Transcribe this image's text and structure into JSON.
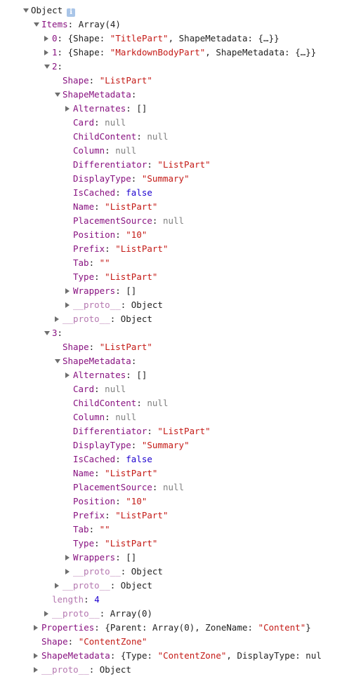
{
  "root": {
    "label": "Object",
    "info_icon": "info-icon",
    "info_glyph": "i"
  },
  "rows": [
    {
      "depth": 0,
      "toggle": "expanded",
      "segs": [
        {
          "t": "Object",
          "c": "p"
        }
      ],
      "badge": true,
      "name": "root-object-node"
    },
    {
      "depth": 1,
      "toggle": "expanded",
      "segs": [
        {
          "t": "Items",
          "c": "k"
        },
        {
          "t": ": Array(4)",
          "c": "p"
        }
      ],
      "name": "items-node"
    },
    {
      "depth": 2,
      "toggle": "collapsed",
      "segs": [
        {
          "t": "0",
          "c": "k"
        },
        {
          "t": ": {Shape: ",
          "c": "p"
        },
        {
          "t": "\"TitlePart\"",
          "c": "s"
        },
        {
          "t": ", ShapeMetadata: {…}}",
          "c": "p"
        }
      ],
      "name": "items-entry-0"
    },
    {
      "depth": 2,
      "toggle": "collapsed",
      "segs": [
        {
          "t": "1",
          "c": "k"
        },
        {
          "t": ": {Shape: ",
          "c": "p"
        },
        {
          "t": "\"MarkdownBodyPart\"",
          "c": "s"
        },
        {
          "t": ", ShapeMetadata: {…}}",
          "c": "p"
        }
      ],
      "name": "items-entry-1"
    },
    {
      "depth": 2,
      "toggle": "expanded",
      "segs": [
        {
          "t": "2",
          "c": "k"
        },
        {
          "t": ":",
          "c": "p"
        }
      ],
      "name": "items-entry-2"
    },
    {
      "depth": 3,
      "toggle": "none",
      "segs": [
        {
          "t": "Shape",
          "c": "k"
        },
        {
          "t": ": ",
          "c": "p"
        },
        {
          "t": "\"ListPart\"",
          "c": "s"
        }
      ],
      "name": "property-shape"
    },
    {
      "depth": 3,
      "toggle": "expanded",
      "segs": [
        {
          "t": "ShapeMetadata",
          "c": "k"
        },
        {
          "t": ":",
          "c": "p"
        }
      ],
      "name": "shape-metadata-node"
    },
    {
      "depth": 4,
      "toggle": "collapsed",
      "segs": [
        {
          "t": "Alternates",
          "c": "k"
        },
        {
          "t": ": []",
          "c": "p"
        }
      ],
      "name": "property-alternates"
    },
    {
      "depth": 4,
      "toggle": "none",
      "segs": [
        {
          "t": "Card",
          "c": "k"
        },
        {
          "t": ": ",
          "c": "p"
        },
        {
          "t": "null",
          "c": "nul"
        }
      ],
      "name": "property-card"
    },
    {
      "depth": 4,
      "toggle": "none",
      "segs": [
        {
          "t": "ChildContent",
          "c": "k"
        },
        {
          "t": ": ",
          "c": "p"
        },
        {
          "t": "null",
          "c": "nul"
        }
      ],
      "name": "property-child-content"
    },
    {
      "depth": 4,
      "toggle": "none",
      "segs": [
        {
          "t": "Column",
          "c": "k"
        },
        {
          "t": ": ",
          "c": "p"
        },
        {
          "t": "null",
          "c": "nul"
        }
      ],
      "name": "property-column"
    },
    {
      "depth": 4,
      "toggle": "none",
      "segs": [
        {
          "t": "Differentiator",
          "c": "k"
        },
        {
          "t": ": ",
          "c": "p"
        },
        {
          "t": "\"ListPart\"",
          "c": "s"
        }
      ],
      "name": "property-differentiator"
    },
    {
      "depth": 4,
      "toggle": "none",
      "segs": [
        {
          "t": "DisplayType",
          "c": "k"
        },
        {
          "t": ": ",
          "c": "p"
        },
        {
          "t": "\"Summary\"",
          "c": "s"
        }
      ],
      "name": "property-display-type"
    },
    {
      "depth": 4,
      "toggle": "none",
      "segs": [
        {
          "t": "IsCached",
          "c": "k"
        },
        {
          "t": ": ",
          "c": "p"
        },
        {
          "t": "false",
          "c": "n"
        }
      ],
      "name": "property-is-cached"
    },
    {
      "depth": 4,
      "toggle": "none",
      "segs": [
        {
          "t": "Name",
          "c": "k"
        },
        {
          "t": ": ",
          "c": "p"
        },
        {
          "t": "\"ListPart\"",
          "c": "s"
        }
      ],
      "name": "property-name"
    },
    {
      "depth": 4,
      "toggle": "none",
      "segs": [
        {
          "t": "PlacementSource",
          "c": "k"
        },
        {
          "t": ": ",
          "c": "p"
        },
        {
          "t": "null",
          "c": "nul"
        }
      ],
      "name": "property-placement-source"
    },
    {
      "depth": 4,
      "toggle": "none",
      "segs": [
        {
          "t": "Position",
          "c": "k"
        },
        {
          "t": ": ",
          "c": "p"
        },
        {
          "t": "\"10\"",
          "c": "s"
        }
      ],
      "name": "property-position"
    },
    {
      "depth": 4,
      "toggle": "none",
      "segs": [
        {
          "t": "Prefix",
          "c": "k"
        },
        {
          "t": ": ",
          "c": "p"
        },
        {
          "t": "\"ListPart\"",
          "c": "s"
        }
      ],
      "name": "property-prefix"
    },
    {
      "depth": 4,
      "toggle": "none",
      "segs": [
        {
          "t": "Tab",
          "c": "k"
        },
        {
          "t": ": ",
          "c": "p"
        },
        {
          "t": "\"\"",
          "c": "s"
        }
      ],
      "name": "property-tab"
    },
    {
      "depth": 4,
      "toggle": "none",
      "segs": [
        {
          "t": "Type",
          "c": "k"
        },
        {
          "t": ": ",
          "c": "p"
        },
        {
          "t": "\"ListPart\"",
          "c": "s"
        }
      ],
      "name": "property-type"
    },
    {
      "depth": 4,
      "toggle": "collapsed",
      "segs": [
        {
          "t": "Wrappers",
          "c": "k"
        },
        {
          "t": ": []",
          "c": "p"
        }
      ],
      "name": "property-wrappers"
    },
    {
      "depth": 4,
      "toggle": "collapsed",
      "segs": [
        {
          "t": "__proto__",
          "c": "k dim"
        },
        {
          "t": ": Object",
          "c": "p"
        }
      ],
      "name": "proto-node"
    },
    {
      "depth": 3,
      "toggle": "collapsed",
      "segs": [
        {
          "t": "__proto__",
          "c": "k dim"
        },
        {
          "t": ": Object",
          "c": "p"
        }
      ],
      "name": "proto-node"
    },
    {
      "depth": 2,
      "toggle": "expanded",
      "segs": [
        {
          "t": "3",
          "c": "k"
        },
        {
          "t": ":",
          "c": "p"
        }
      ],
      "name": "items-entry-3"
    },
    {
      "depth": 3,
      "toggle": "none",
      "segs": [
        {
          "t": "Shape",
          "c": "k"
        },
        {
          "t": ": ",
          "c": "p"
        },
        {
          "t": "\"ListPart\"",
          "c": "s"
        }
      ],
      "name": "property-shape"
    },
    {
      "depth": 3,
      "toggle": "expanded",
      "segs": [
        {
          "t": "ShapeMetadata",
          "c": "k"
        },
        {
          "t": ":",
          "c": "p"
        }
      ],
      "name": "shape-metadata-node"
    },
    {
      "depth": 4,
      "toggle": "collapsed",
      "segs": [
        {
          "t": "Alternates",
          "c": "k"
        },
        {
          "t": ": []",
          "c": "p"
        }
      ],
      "name": "property-alternates"
    },
    {
      "depth": 4,
      "toggle": "none",
      "segs": [
        {
          "t": "Card",
          "c": "k"
        },
        {
          "t": ": ",
          "c": "p"
        },
        {
          "t": "null",
          "c": "nul"
        }
      ],
      "name": "property-card"
    },
    {
      "depth": 4,
      "toggle": "none",
      "segs": [
        {
          "t": "ChildContent",
          "c": "k"
        },
        {
          "t": ": ",
          "c": "p"
        },
        {
          "t": "null",
          "c": "nul"
        }
      ],
      "name": "property-child-content"
    },
    {
      "depth": 4,
      "toggle": "none",
      "segs": [
        {
          "t": "Column",
          "c": "k"
        },
        {
          "t": ": ",
          "c": "p"
        },
        {
          "t": "null",
          "c": "nul"
        }
      ],
      "name": "property-column"
    },
    {
      "depth": 4,
      "toggle": "none",
      "segs": [
        {
          "t": "Differentiator",
          "c": "k"
        },
        {
          "t": ": ",
          "c": "p"
        },
        {
          "t": "\"ListPart\"",
          "c": "s"
        }
      ],
      "name": "property-differentiator"
    },
    {
      "depth": 4,
      "toggle": "none",
      "segs": [
        {
          "t": "DisplayType",
          "c": "k"
        },
        {
          "t": ": ",
          "c": "p"
        },
        {
          "t": "\"Summary\"",
          "c": "s"
        }
      ],
      "name": "property-display-type"
    },
    {
      "depth": 4,
      "toggle": "none",
      "segs": [
        {
          "t": "IsCached",
          "c": "k"
        },
        {
          "t": ": ",
          "c": "p"
        },
        {
          "t": "false",
          "c": "n"
        }
      ],
      "name": "property-is-cached"
    },
    {
      "depth": 4,
      "toggle": "none",
      "segs": [
        {
          "t": "Name",
          "c": "k"
        },
        {
          "t": ": ",
          "c": "p"
        },
        {
          "t": "\"ListPart\"",
          "c": "s"
        }
      ],
      "name": "property-name"
    },
    {
      "depth": 4,
      "toggle": "none",
      "segs": [
        {
          "t": "PlacementSource",
          "c": "k"
        },
        {
          "t": ": ",
          "c": "p"
        },
        {
          "t": "null",
          "c": "nul"
        }
      ],
      "name": "property-placement-source"
    },
    {
      "depth": 4,
      "toggle": "none",
      "segs": [
        {
          "t": "Position",
          "c": "k"
        },
        {
          "t": ": ",
          "c": "p"
        },
        {
          "t": "\"10\"",
          "c": "s"
        }
      ],
      "name": "property-position"
    },
    {
      "depth": 4,
      "toggle": "none",
      "segs": [
        {
          "t": "Prefix",
          "c": "k"
        },
        {
          "t": ": ",
          "c": "p"
        },
        {
          "t": "\"ListPart\"",
          "c": "s"
        }
      ],
      "name": "property-prefix"
    },
    {
      "depth": 4,
      "toggle": "none",
      "segs": [
        {
          "t": "Tab",
          "c": "k"
        },
        {
          "t": ": ",
          "c": "p"
        },
        {
          "t": "\"\"",
          "c": "s"
        }
      ],
      "name": "property-tab"
    },
    {
      "depth": 4,
      "toggle": "none",
      "segs": [
        {
          "t": "Type",
          "c": "k"
        },
        {
          "t": ": ",
          "c": "p"
        },
        {
          "t": "\"ListPart\"",
          "c": "s"
        }
      ],
      "name": "property-type"
    },
    {
      "depth": 4,
      "toggle": "collapsed",
      "segs": [
        {
          "t": "Wrappers",
          "c": "k"
        },
        {
          "t": ": []",
          "c": "p"
        }
      ],
      "name": "property-wrappers"
    },
    {
      "depth": 4,
      "toggle": "collapsed",
      "segs": [
        {
          "t": "__proto__",
          "c": "k dim"
        },
        {
          "t": ": Object",
          "c": "p"
        }
      ],
      "name": "proto-node"
    },
    {
      "depth": 3,
      "toggle": "collapsed",
      "segs": [
        {
          "t": "__proto__",
          "c": "k dim"
        },
        {
          "t": ": Object",
          "c": "p"
        }
      ],
      "name": "proto-node"
    },
    {
      "depth": 2,
      "toggle": "none",
      "segs": [
        {
          "t": "length",
          "c": "k dim"
        },
        {
          "t": ": ",
          "c": "p"
        },
        {
          "t": "4",
          "c": "n"
        }
      ],
      "name": "property-length"
    },
    {
      "depth": 2,
      "toggle": "collapsed",
      "segs": [
        {
          "t": "__proto__",
          "c": "k dim"
        },
        {
          "t": ": Array(0)",
          "c": "p"
        }
      ],
      "name": "proto-node"
    },
    {
      "depth": 1,
      "toggle": "collapsed",
      "segs": [
        {
          "t": "Properties",
          "c": "k"
        },
        {
          "t": ": {Parent: Array(0), ZoneName: ",
          "c": "p"
        },
        {
          "t": "\"Content\"",
          "c": "s"
        },
        {
          "t": "}",
          "c": "p"
        }
      ],
      "name": "properties-node"
    },
    {
      "depth": 1,
      "toggle": "none",
      "segs": [
        {
          "t": "Shape",
          "c": "k"
        },
        {
          "t": ": ",
          "c": "p"
        },
        {
          "t": "\"ContentZone\"",
          "c": "s"
        }
      ],
      "name": "property-shape"
    },
    {
      "depth": 1,
      "toggle": "collapsed",
      "segs": [
        {
          "t": "ShapeMetadata",
          "c": "k"
        },
        {
          "t": ": {Type: ",
          "c": "p"
        },
        {
          "t": "\"ContentZone\"",
          "c": "s"
        },
        {
          "t": ", DisplayType: nul",
          "c": "p"
        }
      ],
      "name": "shape-metadata-node"
    },
    {
      "depth": 1,
      "toggle": "collapsed",
      "segs": [
        {
          "t": "__proto__",
          "c": "k dim"
        },
        {
          "t": ": Object",
          "c": "p"
        }
      ],
      "name": "proto-node"
    }
  ],
  "colors": {
    "key": "#881280",
    "key_dim": "#b578b0",
    "string": "#c41a16",
    "number": "#1c00cf",
    "null": "#7f7f7f",
    "text": "#222222",
    "badge": "#a9c5e8"
  }
}
